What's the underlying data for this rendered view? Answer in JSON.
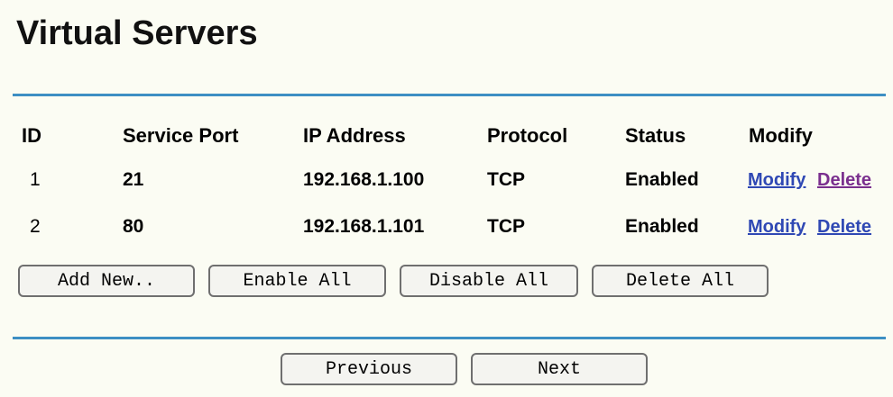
{
  "page": {
    "title": "Virtual Servers"
  },
  "table": {
    "headers": [
      "ID",
      "Service Port",
      "IP Address",
      "Protocol",
      "Status",
      "Modify"
    ],
    "rows": [
      {
        "id": "1",
        "service_port": "21",
        "ip_address": "192.168.1.100",
        "protocol": "TCP",
        "status": "Enabled",
        "modify_label": "Modify",
        "delete_label": "Delete"
      },
      {
        "id": "2",
        "service_port": "80",
        "ip_address": "192.168.1.101",
        "protocol": "TCP",
        "status": "Enabled",
        "modify_label": "Modify",
        "delete_label": "Delete"
      }
    ]
  },
  "actions": {
    "add_new": "Add New..",
    "enable_all": "Enable All",
    "disable_all": "Disable All",
    "delete_all": "Delete All"
  },
  "navigation": {
    "previous": "Previous",
    "next": "Next"
  },
  "colors": {
    "rule": "#3d8fc3",
    "link": "#2f48b4",
    "visited_link": "#7a2f8e",
    "background": "#fbfcf3"
  }
}
